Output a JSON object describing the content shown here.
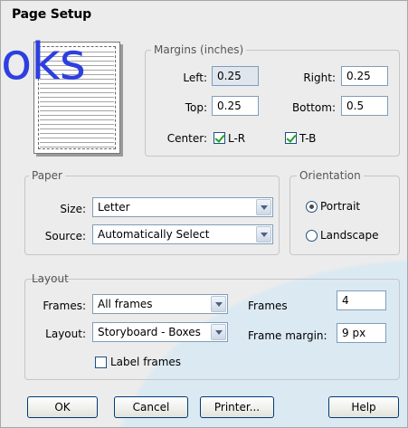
{
  "window": {
    "title": "Page Setup"
  },
  "watermark_text": "oks",
  "margins": {
    "legend": "Margins (inches)",
    "left_label": "Left:",
    "left_value": "0.25",
    "right_label": "Right:",
    "right_value": "0.25",
    "top_label": "Top:",
    "top_value": "0.25",
    "bottom_label": "Bottom:",
    "bottom_value": "0.5",
    "center_label": "Center:",
    "center_lr_label": "L-R",
    "center_lr_checked": true,
    "center_tb_label": "T-B",
    "center_tb_checked": true
  },
  "paper": {
    "legend": "Paper",
    "size_label": "Size:",
    "size_value": "Letter",
    "source_label": "Source:",
    "source_value": "Automatically Select"
  },
  "orientation": {
    "legend": "Orientation",
    "portrait_label": "Portrait",
    "portrait_selected": true,
    "landscape_label": "Landscape",
    "landscape_selected": false
  },
  "layout": {
    "legend": "Layout",
    "frames_label": "Frames:",
    "frames_value": "All frames",
    "layout_label": "Layout:",
    "layout_value": "Storyboard - Boxes",
    "frames_count_label": "Frames",
    "frames_count_value": "4",
    "frame_margin_label": "Frame margin:",
    "frame_margin_value": "9 px",
    "label_frames_label": "Label frames",
    "label_frames_checked": false
  },
  "buttons": {
    "ok": "OK",
    "cancel": "Cancel",
    "printer": "Printer...",
    "help": "Help"
  }
}
